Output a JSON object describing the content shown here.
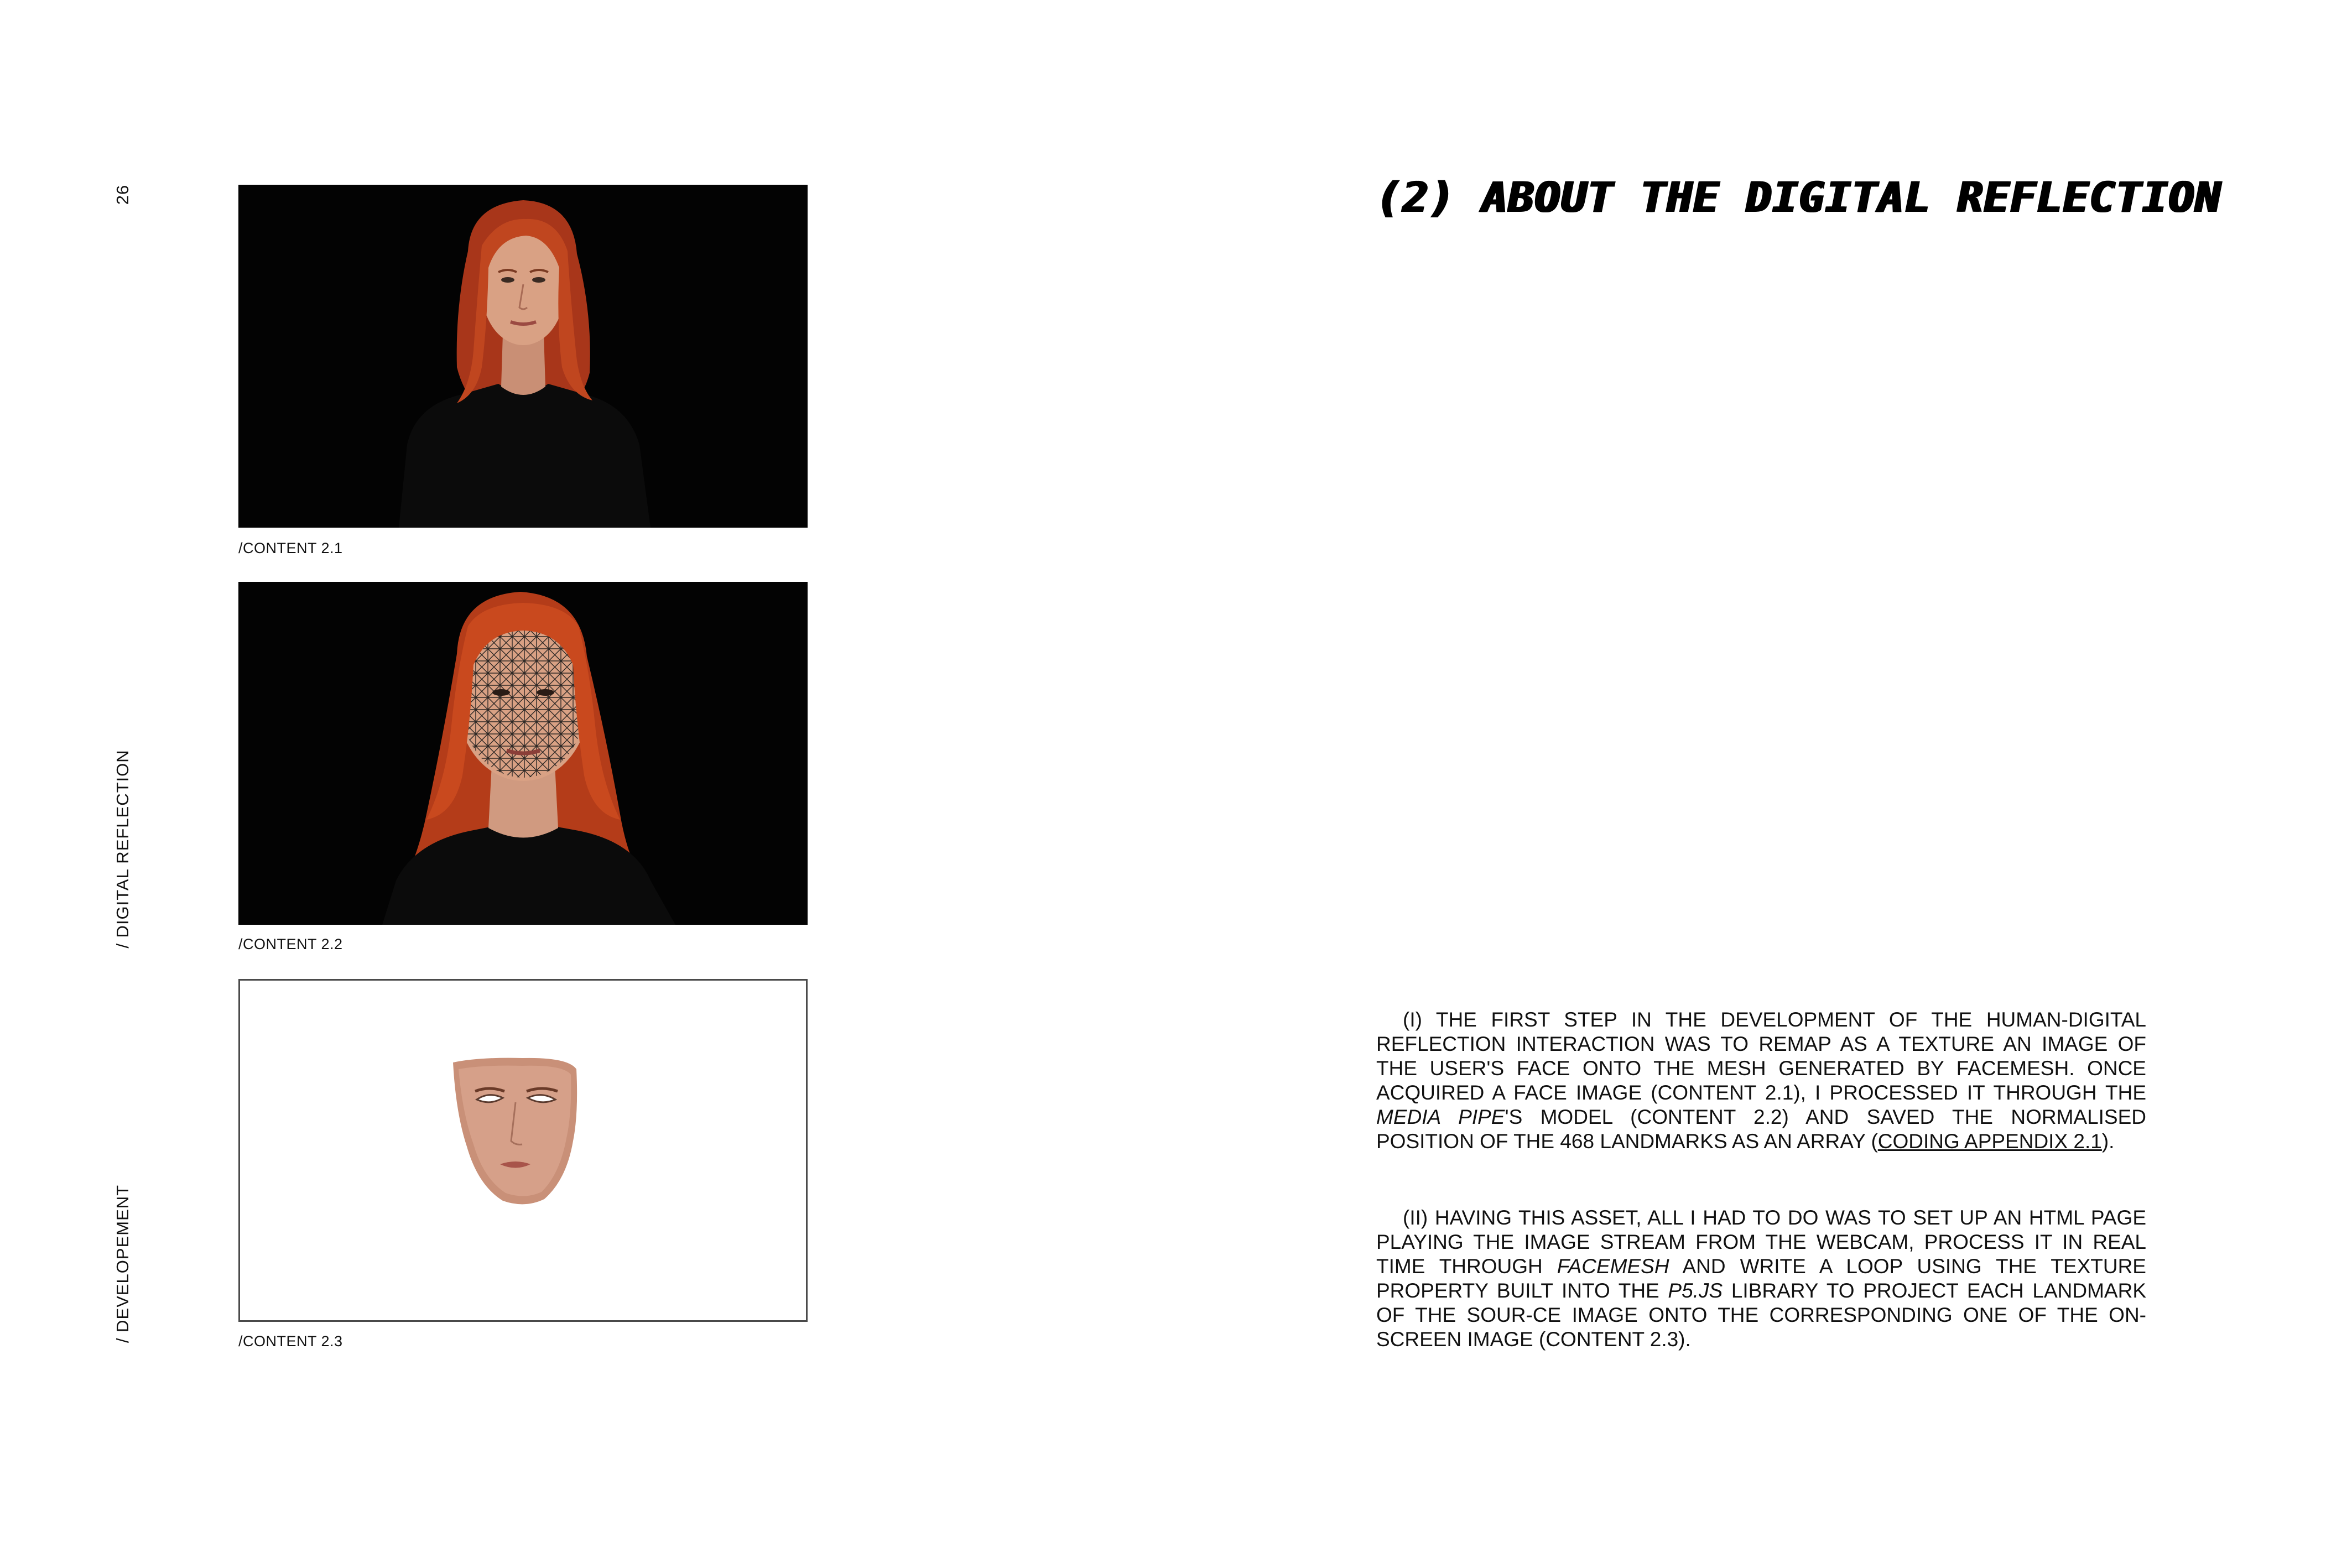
{
  "page": {
    "number": "26",
    "section": "/ DIGITAL REFLECTION",
    "subsection": "/ DEVELOPEMENT"
  },
  "figures": [
    {
      "caption": "/CONTENT 2.1",
      "image_desc": "Portrait of a red-haired woman in a black t-shirt on black background"
    },
    {
      "caption": "/CONTENT 2.2",
      "image_desc": "Same portrait with a triangular face mesh overlaid on the face"
    },
    {
      "caption": "/CONTENT 2.3",
      "image_desc": "Isolated face texture mask on white background"
    }
  ],
  "heading": "(2) ABOUT THE DIGITAL REFLECTION",
  "paragraphs": {
    "p1": {
      "a": "(I) THE FIRST STEP IN THE DEVELOPMENT OF THE HUMAN-DIGITAL REFLECTION INTERACTION WAS TO REMAP AS A TEXTURE AN IMAGE OF THE USER'S FACE ONTO THE MESH GENERATED BY FACEMESH. ONCE ACQUIRED A FACE IMAGE (CONTENT 2.1), I PROCESSED IT THROUGH THE ",
      "b": "MEDIA PIPE",
      "c": "'S MODEL (CONTENT 2.2) AND SAVED THE NORMALISED POSITION OF THE 468 LANDMARKS AS AN ARRAY (",
      "link": "CODING APPENDIX 2.1",
      "d": ")."
    },
    "p2": {
      "a": "(II) HAVING THIS ASSET, ALL I HAD TO DO WAS TO SET UP AN HTML PAGE PLAYING THE IMAGE STREAM FROM THE WEBCAM, PROCESS IT IN REAL TIME THROUGH ",
      "b": "FACEMESH",
      "c": " AND WRITE A LOOP USING THE TEXTURE PROPERTY BUILT INTO THE ",
      "d": "P5.JS",
      "e": " LIBRARY TO PROJECT EACH LANDMARK OF THE SOUR-CE IMAGE ONTO THE CORRESPONDING ONE OF THE ON-SCREEN IMAGE (CONTENT 2.3)."
    }
  },
  "colors": {
    "background": "#ffffff",
    "text": "#111111",
    "photo_bg": "#030303",
    "hair": "#b8401c",
    "skin": "#d9a184"
  }
}
